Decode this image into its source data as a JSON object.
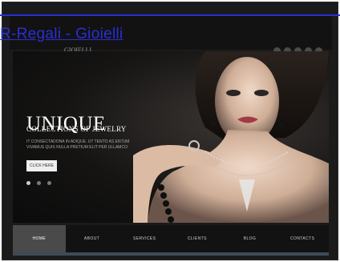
{
  "page": {
    "link_title": "R-Regali - Gioielli"
  },
  "header": {
    "brand_sub": "GIOIELLI",
    "pager_dots": 5
  },
  "hero": {
    "title": "UNIQUE",
    "subtitle": "COLLECTIONS OF JEWELRY",
    "text": "IT CONSECTADONA IN ADIQUE. UT TENTO AS ENTUM VIVAMUS QUIS NULLA PRETIUM ELIT PER ULLAMCO",
    "button_label": "CLICK HERE",
    "slide_dots": 3,
    "active_slide": 1
  },
  "nav": {
    "items": [
      {
        "label": "HOME",
        "active": true
      },
      {
        "label": "ABOUT",
        "active": false
      },
      {
        "label": "SERVICES",
        "active": false
      },
      {
        "label": "CLIENTS",
        "active": false
      },
      {
        "label": "BLOG",
        "active": false
      },
      {
        "label": "CONTACTS",
        "active": false
      }
    ]
  },
  "colors": {
    "link": "#2a2fd6",
    "background": "#1b1b1b",
    "nav_active": "#4a4a4a"
  }
}
